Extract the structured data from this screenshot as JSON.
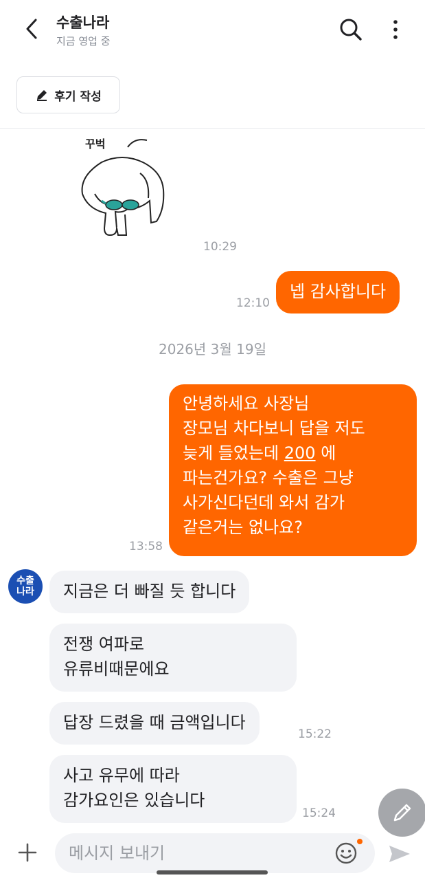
{
  "header": {
    "title": "수출나라",
    "subtitle": "지금 영업 중",
    "icons": {
      "back": "back-arrow-icon",
      "search": "search-icon",
      "more": "more-vertical-icon"
    }
  },
  "review_button": {
    "label": "후기 작성",
    "icon": "pencil-icon"
  },
  "sticker": {
    "text": "꾸벅",
    "time": "10:29"
  },
  "messages": [
    {
      "direction": "outgoing",
      "text": "넵 감사합니다",
      "time": "12:10"
    },
    {
      "direction": "outgoing",
      "lines": [
        "안녕하세요 사장님",
        "장모님 차다보니 답을 저도",
        "늦게 들었는데 ",
        "200",
        " 에",
        "파는건가요? 수출은 그냥",
        "사가신다던데 와서 감가",
        "같은거는 없나요?"
      ],
      "time": "13:58"
    },
    {
      "direction": "incoming",
      "text": "지금은 더 빠질 듯 합니다"
    },
    {
      "direction": "incoming",
      "lines": [
        "전쟁 여파로",
        "유류비때문에요"
      ]
    },
    {
      "direction": "incoming",
      "text": "답장 드렸을 때 금액입니다",
      "time": "15:22"
    },
    {
      "direction": "incoming",
      "lines": [
        "사고 유무에 따라",
        "감가요인은 있습니다"
      ],
      "time": "15:24"
    }
  ],
  "date_separator": "2026년 3월 19일",
  "avatar": {
    "line1": "수출",
    "line2": "나라"
  },
  "composer": {
    "placeholder": "메시지 보내기",
    "icons": {
      "plus": "plus-icon",
      "emoji": "emoji-icon",
      "send": "send-icon",
      "fab": "pencil-fab-icon"
    }
  },
  "colors": {
    "accent": "#ff6600",
    "incoming_bubble": "#f2f3f6",
    "avatar": "#1b4fb3"
  }
}
